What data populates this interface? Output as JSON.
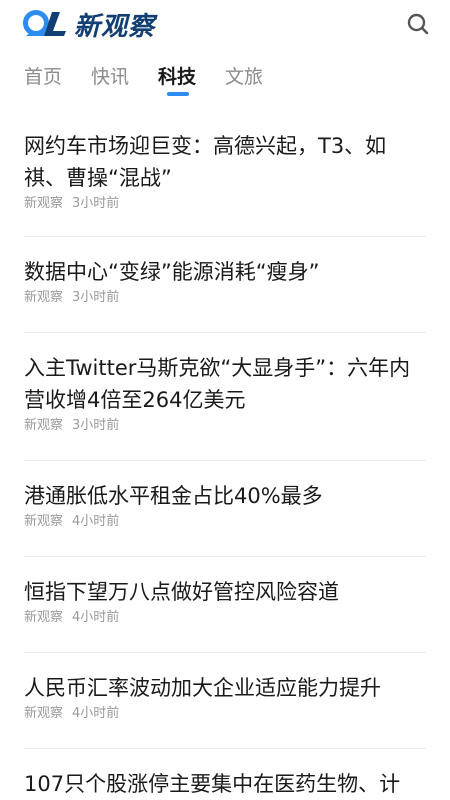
{
  "header": {
    "logo_text": "新观察",
    "logo_icon": "ol-logo-icon",
    "search_icon": "search-icon",
    "brand_color": "#123f73",
    "accent_color": "#2d8cf0"
  },
  "tabs": [
    {
      "label": "首页",
      "active": false
    },
    {
      "label": "快讯",
      "active": false
    },
    {
      "label": "科技",
      "active": true
    },
    {
      "label": "文旅",
      "active": false
    }
  ],
  "articles": [
    {
      "title": "网约车市场迎巨变：高德兴起，T3、如祺、曹操“混战”",
      "source": "新观察",
      "time": "3小时前"
    },
    {
      "title": "数据中心“变绿”能源消耗“瘦身”",
      "source": "新观察",
      "time": "3小时前"
    },
    {
      "title": "入主Twitter马斯克欲“大显身手”：六年内营收增4倍至264亿美元",
      "source": "新观察",
      "time": "3小时前"
    },
    {
      "title": "港通胀低水平租金占比40%最多",
      "source": "新观察",
      "time": "4小时前"
    },
    {
      "title": "恒指下望万八点做好管控风险容道",
      "source": "新观察",
      "time": "4小时前"
    },
    {
      "title": "人民币汇率波动加大企业适应能力提升",
      "source": "新观察",
      "time": "4小时前"
    },
    {
      "title": "107只个股涨停主要集中在医药生物、计",
      "source": "",
      "time": ""
    }
  ]
}
